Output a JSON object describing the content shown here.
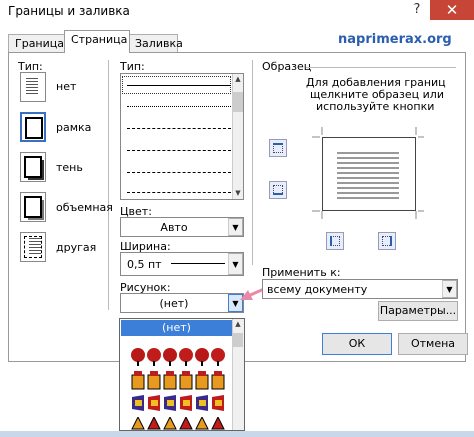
{
  "window": {
    "title": "Границы и заливка",
    "help_glyph": "?",
    "close_glyph": "✕"
  },
  "tabs": [
    {
      "label": "Граница"
    },
    {
      "label": "Страница"
    },
    {
      "label": "Заливка"
    }
  ],
  "watermark": "naprimerax.org",
  "type_group": {
    "label": "Тип:",
    "items": [
      {
        "label": "нет"
      },
      {
        "label": "рамка"
      },
      {
        "label": "тень"
      },
      {
        "label": "объемная"
      },
      {
        "label": "другая"
      }
    ]
  },
  "style_group": {
    "label": "Тип:"
  },
  "color": {
    "label": "Цвет:",
    "value": "Авто"
  },
  "width": {
    "label": "Ширина:",
    "value": "0,5 пт"
  },
  "art": {
    "label": "Рисунок:",
    "value": "(нет)"
  },
  "art_dropdown": {
    "selected": "(нет)"
  },
  "preview": {
    "label": "Образец",
    "hint_line1": "Для добавления границ",
    "hint_line2": "щелкните образец или",
    "hint_line3": "используйте кнопки"
  },
  "apply_to": {
    "label": "Применить к:",
    "value": "всему документу"
  },
  "buttons": {
    "options": "Параметры...",
    "ok": "ОК",
    "cancel": "Отмена"
  },
  "colors": {
    "accent": "#3c7fd8",
    "arrow": "#e88aa6",
    "close": "#c74537"
  }
}
